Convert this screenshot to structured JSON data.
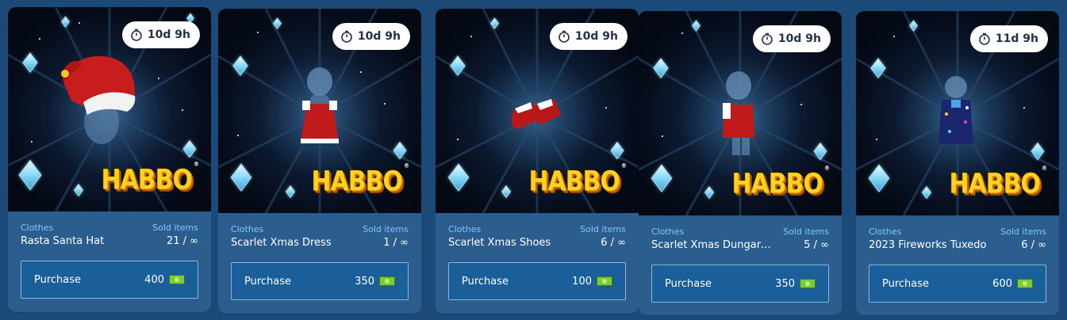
{
  "cards": [
    {
      "timer": "10d 9h",
      "category": "Clothes",
      "name": "Rasta Santa Hat",
      "sold_label": "Sold items",
      "sold": "21 / ∞",
      "purchase_label": "Purchase",
      "price": "400",
      "item_icon": "santa-hat"
    },
    {
      "timer": "10d 9h",
      "category": "Clothes",
      "name": "Scarlet Xmas Dress",
      "sold_label": "Sold items",
      "sold": "1 / ∞",
      "purchase_label": "Purchase",
      "price": "350",
      "item_icon": "xmas-dress"
    },
    {
      "timer": "10d 9h",
      "category": "Clothes",
      "name": "Scarlet Xmas Shoes",
      "sold_label": "Sold items",
      "sold": "6 / ∞",
      "purchase_label": "Purchase",
      "price": "100",
      "item_icon": "xmas-shoes"
    },
    {
      "timer": "10d 9h",
      "category": "Clothes",
      "name": "Scarlet Xmas Dungarees",
      "sold_label": "Sold items",
      "sold": "5 / ∞",
      "purchase_label": "Purchase",
      "price": "350",
      "item_icon": "xmas-dungarees"
    },
    {
      "timer": "11d 9h",
      "category": "Clothes",
      "name": "2023 Fireworks Tuxedo",
      "sold_label": "Sold items",
      "sold": "6 / ∞",
      "purchase_label": "Purchase",
      "price": "600",
      "item_icon": "fireworks-tuxedo"
    }
  ],
  "brand": {
    "logo_text": "HABBO",
    "logo_mark": "®"
  },
  "colors": {
    "page_bg": "#1c4a78",
    "card_bg": "#2c5d8f",
    "button_bg": "#1a5f99",
    "label": "#7fc8ff",
    "logo": "#ffd21f"
  }
}
